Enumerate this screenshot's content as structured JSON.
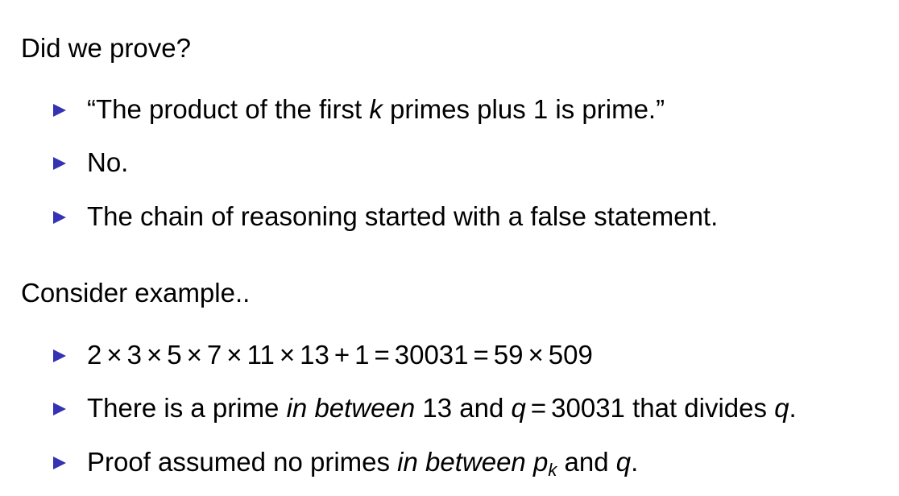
{
  "section1": {
    "heading": "Did we prove?",
    "bullets": [
      {
        "a": "“The product of the first ",
        "k": "k",
        "b": " primes plus 1 is prime.”"
      },
      {
        "a": "No."
      },
      {
        "a": "The chain of reasoning started with a false statement."
      }
    ]
  },
  "section2": {
    "heading": "Consider example..",
    "equation": [
      "2",
      "×",
      "3",
      "×",
      "5",
      "×",
      "7",
      "×",
      "11",
      "×",
      "13",
      "+",
      "1",
      "=",
      "30031",
      "=",
      "59",
      "×",
      "509"
    ],
    "bullet2": {
      "a": "There is a prime ",
      "em": "in between",
      "b": " 13 and ",
      "q": "q",
      "eq": "=",
      "c": "30031 that divides ",
      "q2": "q",
      "d": "."
    },
    "bullet3": {
      "a": "Proof assumed no primes ",
      "em": "in between",
      "p": "p",
      "sub": "k",
      "b": " and ",
      "q": "q",
      "d": "."
    }
  },
  "colors": {
    "bullet": "#3333b3"
  }
}
